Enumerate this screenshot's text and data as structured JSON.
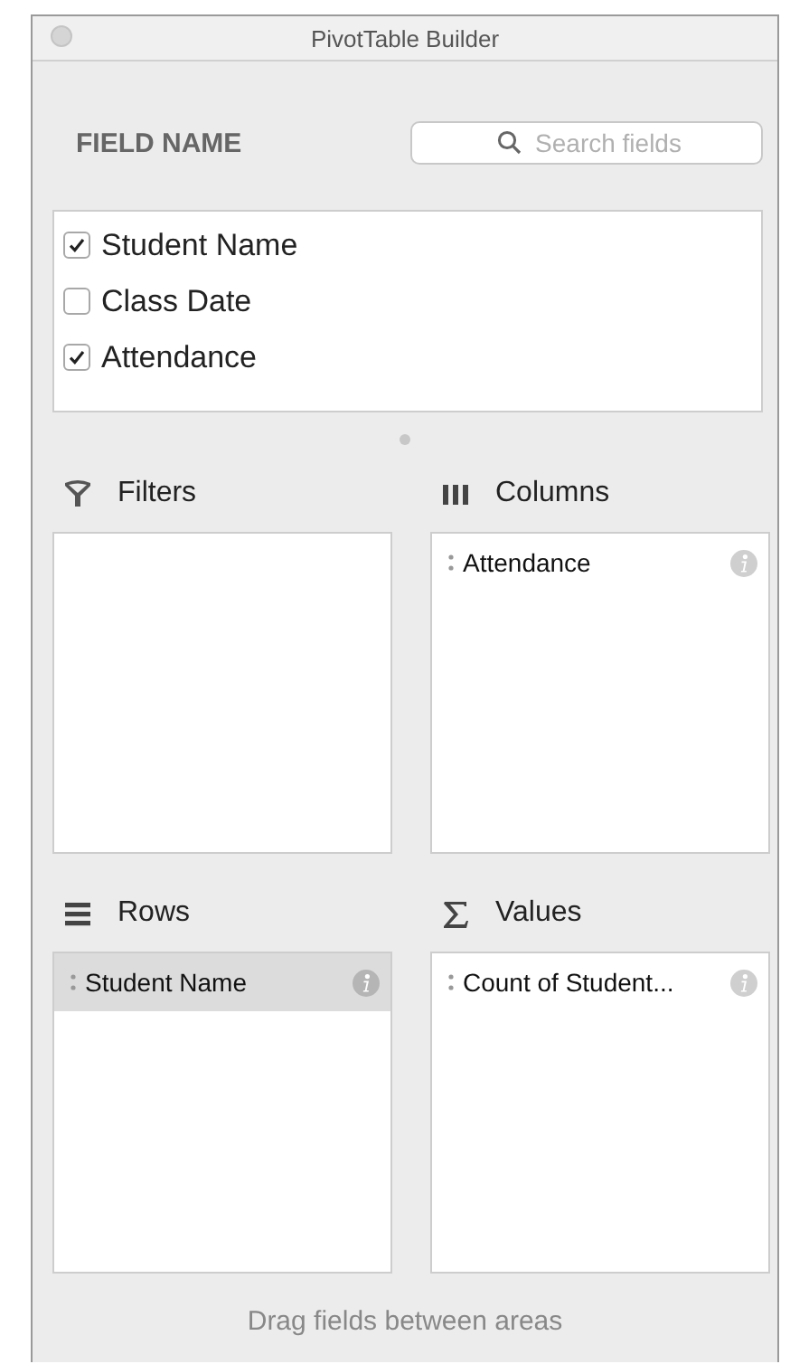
{
  "window": {
    "title": "PivotTable Builder"
  },
  "field_header": "FIELD NAME",
  "search": {
    "placeholder": "Search fields"
  },
  "fields": [
    {
      "label": "Student Name",
      "checked": true
    },
    {
      "label": "Class Date",
      "checked": false
    },
    {
      "label": "Attendance",
      "checked": true
    }
  ],
  "areas": [
    {
      "kind": "filters",
      "title": "Filters"
    },
    {
      "kind": "columns",
      "title": "Columns",
      "items": [
        {
          "label": "Attendance",
          "selected": false
        }
      ]
    },
    {
      "kind": "rows",
      "title": "Rows",
      "items": [
        {
          "label": "Student Name",
          "selected": true
        }
      ]
    },
    {
      "kind": "values",
      "title": "Values",
      "items": [
        {
          "label": "Count of Student...",
          "selected": false
        }
      ]
    }
  ],
  "status_bar": "Drag fields between areas"
}
